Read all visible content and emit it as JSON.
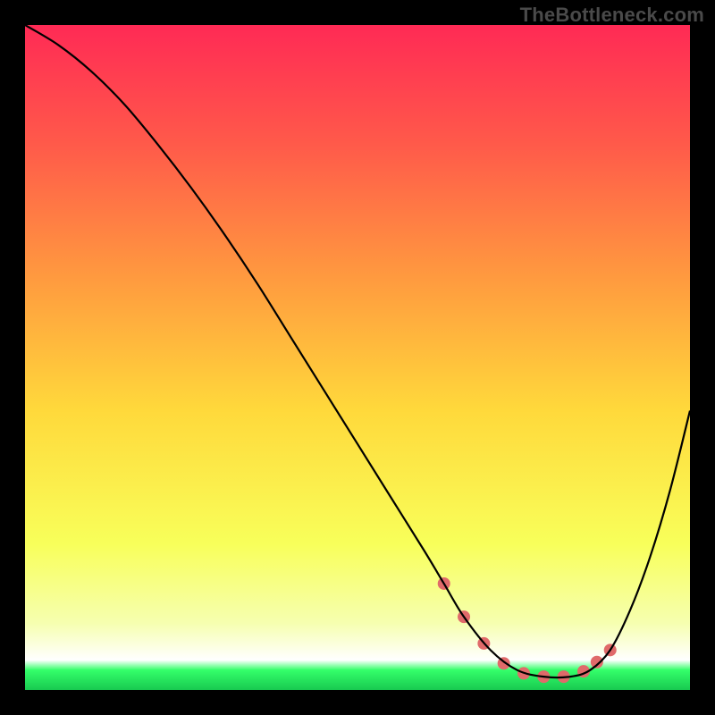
{
  "watermark": "TheBottleneck.com",
  "chart_data": {
    "type": "line",
    "title": "",
    "xlabel": "",
    "ylabel": "",
    "xlim": [
      0,
      100
    ],
    "ylim": [
      0,
      100
    ],
    "grid": false,
    "background_gradient": {
      "stops": [
        {
          "offset": 0.0,
          "color": "#ff2a55"
        },
        {
          "offset": 0.18,
          "color": "#ff5a4a"
        },
        {
          "offset": 0.38,
          "color": "#ff9a3f"
        },
        {
          "offset": 0.58,
          "color": "#ffd93b"
        },
        {
          "offset": 0.78,
          "color": "#f8ff5a"
        },
        {
          "offset": 0.9,
          "color": "#f6ffb0"
        },
        {
          "offset": 0.955,
          "color": "#ffffff"
        },
        {
          "offset": 0.97,
          "color": "#34ff6a"
        },
        {
          "offset": 1.0,
          "color": "#18c950"
        }
      ]
    },
    "series": [
      {
        "name": "curve",
        "stroke": "#000000",
        "stroke_width": 2.2,
        "x": [
          0,
          5,
          10,
          15,
          20,
          25,
          30,
          35,
          40,
          45,
          50,
          55,
          60,
          63,
          66,
          70,
          74,
          78,
          82,
          85,
          88,
          91,
          94,
          97,
          100
        ],
        "values": [
          100,
          97,
          93,
          88,
          82,
          75.5,
          68.5,
          61,
          53,
          45,
          37,
          29,
          21,
          16,
          11,
          6,
          3,
          2,
          2,
          3,
          6,
          12,
          20,
          30,
          42
        ]
      }
    ],
    "markers": {
      "name": "highlight-dots",
      "color": "#e06a6a",
      "radius": 7,
      "x": [
        63,
        66,
        69,
        72,
        75,
        78,
        81,
        84,
        86,
        88
      ],
      "values": [
        16,
        11,
        7,
        4,
        2.5,
        2,
        2,
        2.8,
        4.2,
        6
      ]
    }
  }
}
